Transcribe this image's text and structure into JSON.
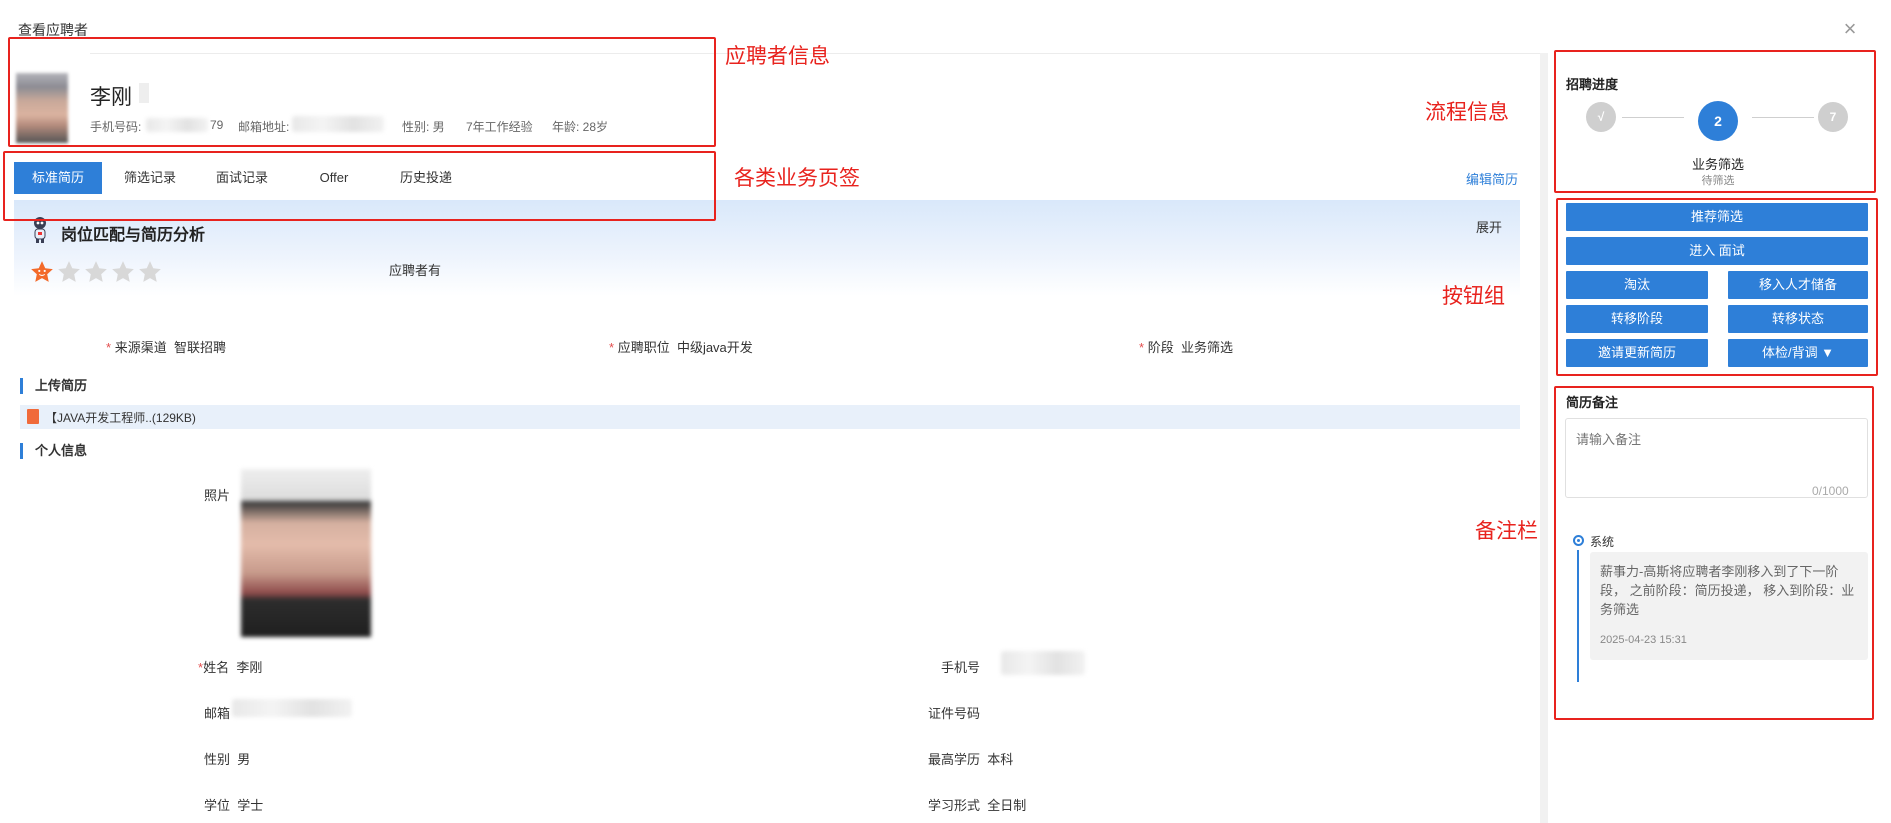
{
  "modal": {
    "title": "查看应聘者"
  },
  "candidate": {
    "name": "李刚",
    "phone_label": "手机号码:",
    "phone_tail": "79",
    "email_label": "邮箱地址:",
    "gender": "性别: 男",
    "experience": "7年工作经验",
    "age": "年龄: 28岁"
  },
  "tabs": [
    {
      "label": "标准简历",
      "active": true
    },
    {
      "label": "筛选记录"
    },
    {
      "label": "面试记录"
    },
    {
      "label": "Offer"
    },
    {
      "label": "历史投递"
    }
  ],
  "edit_resume": "编辑简历",
  "analysis": {
    "title": "岗位匹配与简历分析",
    "expand": "展开",
    "applicant_has": "应聘者有",
    "rating": 1,
    "max_rating": 5
  },
  "fields_top": {
    "source_label": "来源渠道",
    "source_value": "智联招聘",
    "position_label": "应聘职位",
    "position_value": "中级java开发",
    "stage_label": "阶段",
    "stage_value": "业务筛选"
  },
  "upload_section": {
    "title": "上传简历",
    "file": "【JAVA开发工程师..(129KB)"
  },
  "personal_section": {
    "title": "个人信息",
    "photo_label": "照片",
    "name_label": "姓名",
    "name_value": "李刚",
    "phone_label": "手机号",
    "email_label": "邮箱",
    "email_tail": "@",
    "id_label": "证件号码",
    "gender_label": "性别",
    "gender_value": "男",
    "education_label": "最高学历",
    "education_value": "本科",
    "degree_label": "学位",
    "degree_value": "学士",
    "study_label": "学习形式",
    "study_value": "全日制"
  },
  "progress": {
    "title": "招聘进度",
    "steps": [
      {
        "label": "√",
        "state": "done"
      },
      {
        "label": "2",
        "state": "current"
      },
      {
        "label": "7",
        "state": "pending"
      }
    ],
    "current_name": "业务筛选",
    "current_status": "待筛选"
  },
  "buttons": {
    "recommend": "推荐筛选",
    "interview": "进入 面试",
    "eliminate": "淘汰",
    "talent_pool": "移入人才储备",
    "move_stage": "转移阶段",
    "move_status": "转移状态",
    "invite_update": "邀请更新简历",
    "background_check": "体检/背调 ▼"
  },
  "notes": {
    "title": "简历备注",
    "placeholder": "请输入备注",
    "counter": "0/1000",
    "timeline": [
      {
        "author": "系统",
        "message": "薪事力-高斯将应聘者李刚移入到了下一阶段， 之前阶段：简历投递， 移入到阶段：业务筛选",
        "time": "2025-04-23 15:31"
      }
    ]
  },
  "annotations": {
    "applicant_info": "应聘者信息",
    "process_info": "流程信息",
    "business_tabs": "各类业务页签",
    "button_group": "按钮组",
    "notes_bar": "备注栏"
  },
  "colors": {
    "accent": "#2e7fd8",
    "annotation": "#e8231e",
    "star": "#f36a2a"
  }
}
